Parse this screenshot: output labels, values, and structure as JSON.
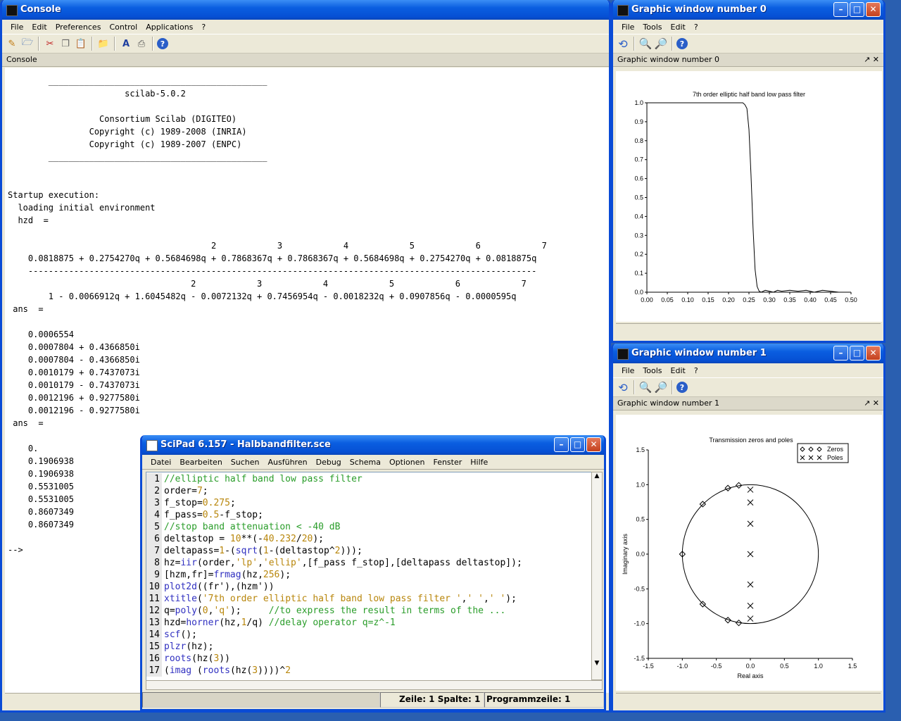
{
  "console": {
    "title": "Console",
    "menu": [
      "File",
      "Edit",
      "Preferences",
      "Control",
      "Applications",
      "?"
    ],
    "tab_label": "Console",
    "lines": [
      "        ___________________________________________",
      "                       scilab-5.0.2",
      "",
      "                  Consortium Scilab (DIGITEO)",
      "                Copyright (c) 1989-2008 (INRIA)",
      "                Copyright (c) 1989-2007 (ENPC)",
      "        ___________________________________________",
      "",
      "",
      "Startup execution:",
      "  loading initial environment",
      "  hzd  =",
      "",
      "                                        2            3            4            5            6            7",
      "    0.0818875 + 0.2754270q + 0.5684698q + 0.7868367q + 0.7868367q + 0.5684698q + 0.2754270q + 0.0818875q",
      "    ----------------------------------------------------------------------------------------------------",
      "                                    2            3            4            5            6            7",
      "        1 - 0.0066912q + 1.6045482q - 0.0072132q + 0.7456954q - 0.0018232q + 0.0907856q - 0.0000595q",
      " ans  =",
      "",
      "    0.0006554",
      "    0.0007804 + 0.4366850i",
      "    0.0007804 - 0.4366850i",
      "    0.0010179 + 0.7437073i",
      "    0.0010179 - 0.7437073i",
      "    0.0012196 + 0.9277580i",
      "    0.0012196 - 0.9277580i",
      " ans  =",
      "",
      "    0.",
      "    0.1906938",
      "    0.1906938",
      "    0.5531005",
      "    0.5531005",
      "    0.8607349",
      "    0.8607349",
      "",
      "-->"
    ]
  },
  "gw0": {
    "title": "Graphic window number 0",
    "menu": [
      "File",
      "Tools",
      "Edit",
      "?"
    ],
    "tab_label": "Graphic window number 0",
    "dock_controls": "↗ ✕",
    "chart_data": {
      "type": "line",
      "title": "7th order elliptic half band low pass filter",
      "xlabel": "",
      "ylabel": "",
      "xlim": [
        0,
        0.5
      ],
      "ylim": [
        0,
        1.0
      ],
      "x_ticks": [
        "0.00",
        "0.05",
        "0.10",
        "0.15",
        "0.20",
        "0.25",
        "0.30",
        "0.35",
        "0.40",
        "0.45",
        "0.50"
      ],
      "y_ticks": [
        "0.0",
        "0.1",
        "0.2",
        "0.3",
        "0.4",
        "0.5",
        "0.6",
        "0.7",
        "0.8",
        "0.9",
        "1.0"
      ],
      "series": [
        {
          "x": [
            0,
            0.22,
            0.235,
            0.24,
            0.245,
            0.25,
            0.255,
            0.26,
            0.265,
            0.27,
            0.275,
            0.28,
            0.29,
            0.3,
            0.31,
            0.32,
            0.33,
            0.35,
            0.37,
            0.39,
            0.41,
            0.43,
            0.45,
            0.47,
            0.5
          ],
          "y": [
            1.0,
            1.0,
            1.0,
            0.99,
            0.97,
            0.86,
            0.62,
            0.34,
            0.12,
            0.03,
            0.005,
            0.0,
            0.01,
            0.005,
            0.0,
            0.01,
            0.005,
            0.01,
            0.005,
            0.01,
            0.0,
            0.01,
            0.005,
            0.0,
            0.0
          ]
        }
      ]
    }
  },
  "gw1": {
    "title": "Graphic window number 1",
    "menu": [
      "File",
      "Tools",
      "Edit",
      "?"
    ],
    "tab_label": "Graphic window number 1",
    "dock_controls": "↗ ✕",
    "chart_data": {
      "type": "scatter",
      "title": "Transmission zeros and poles",
      "xlabel": "Real axis",
      "ylabel": "Imaginary axis",
      "xlim": [
        -1.5,
        1.5
      ],
      "ylim": [
        -1.5,
        1.5
      ],
      "x_ticks": [
        "-1.5",
        "-1.0",
        "-0.5",
        "0.0",
        "0.5",
        "1.0",
        "1.5"
      ],
      "y_ticks": [
        "-1.5",
        "-1.0",
        "-0.5",
        "0.0",
        "0.5",
        "1.0",
        "1.5"
      ],
      "series": [
        {
          "name": "Zeros",
          "marker": "diamond",
          "x": [
            -1.0,
            -0.7,
            -0.7,
            -0.33,
            -0.33,
            -0.17,
            -0.17
          ],
          "y": [
            0.0,
            0.72,
            -0.72,
            0.95,
            -0.95,
            0.99,
            -0.99
          ]
        },
        {
          "name": "Poles",
          "marker": "cross",
          "x": [
            0.0,
            0.0,
            0.0,
            0.0,
            0.0,
            0.0,
            0.0
          ],
          "y": [
            0.0,
            0.437,
            -0.437,
            0.744,
            -0.744,
            0.928,
            -0.928
          ]
        }
      ]
    }
  },
  "scipad": {
    "title": "SciPad 6.157 - Halbbandfilter.sce",
    "menu": [
      "Datei",
      "Bearbeiten",
      "Suchen",
      "Ausführen",
      "Debug",
      "Schema",
      "Optionen",
      "Fenster",
      "Hilfe"
    ],
    "status_pos": "Zeile: 1 Spalte: 1",
    "status_prog": "Programmzeile: 1",
    "code": [
      [
        [
          "cm",
          "//elliptic half band low pass filter"
        ]
      ],
      [
        [
          "pl",
          "order="
        ],
        [
          "nm",
          "7"
        ],
        [
          "pl",
          ";"
        ]
      ],
      [
        [
          "pl",
          "f_stop="
        ],
        [
          "nm",
          "0.275"
        ],
        [
          "pl",
          ";"
        ]
      ],
      [
        [
          "pl",
          "f_pass="
        ],
        [
          "nm",
          "0.5"
        ],
        [
          "pl",
          "-f_stop;"
        ]
      ],
      [
        [
          "cm",
          "//stop band attenuation < -40 dB"
        ]
      ],
      [
        [
          "pl",
          "deltastop = "
        ],
        [
          "nm",
          "10"
        ],
        [
          "pl",
          "**(-"
        ],
        [
          "nm",
          "40.232"
        ],
        [
          "pl",
          "/"
        ],
        [
          "nm",
          "20"
        ],
        [
          "pl",
          ");"
        ]
      ],
      [
        [
          "pl",
          "deltapass="
        ],
        [
          "nm",
          "1"
        ],
        [
          "pl",
          "-("
        ],
        [
          "fn",
          "sqrt"
        ],
        [
          "pl",
          "("
        ],
        [
          "nm",
          "1"
        ],
        [
          "pl",
          "-(deltastop^"
        ],
        [
          "nm",
          "2"
        ],
        [
          "pl",
          ")));"
        ]
      ],
      [
        [
          "pl",
          "hz="
        ],
        [
          "fn",
          "iir"
        ],
        [
          "pl",
          "(order,"
        ],
        [
          "str",
          "'lp'"
        ],
        [
          "pl",
          ","
        ],
        [
          "str",
          "'ellip'"
        ],
        [
          "pl",
          ",[f_pass f_stop],[deltapass deltastop]);"
        ]
      ],
      [
        [
          "pl",
          "[hzm,fr]="
        ],
        [
          "fn",
          "frmag"
        ],
        [
          "pl",
          "(hz,"
        ],
        [
          "nm",
          "256"
        ],
        [
          "pl",
          ");"
        ]
      ],
      [
        [
          "fn",
          "plot2d"
        ],
        [
          "pl",
          "((fr'),(hzm'))"
        ]
      ],
      [
        [
          "fn",
          "xtitle"
        ],
        [
          "pl",
          "("
        ],
        [
          "str",
          "'7th order elliptic half band low pass filter '"
        ],
        [
          "pl",
          ","
        ],
        [
          "str",
          "' '"
        ],
        [
          "pl",
          ","
        ],
        [
          "str",
          "' '"
        ],
        [
          "pl",
          ");"
        ]
      ],
      [
        [
          "pl",
          "q="
        ],
        [
          "fn",
          "poly"
        ],
        [
          "pl",
          "("
        ],
        [
          "nm",
          "0"
        ],
        [
          "pl",
          ","
        ],
        [
          "str",
          "'q'"
        ],
        [
          "pl",
          ");     "
        ],
        [
          "cm",
          "//to express the result in terms of the ..."
        ]
      ],
      [
        [
          "pl",
          "hzd="
        ],
        [
          "fn",
          "horner"
        ],
        [
          "pl",
          "(hz,"
        ],
        [
          "nm",
          "1"
        ],
        [
          "pl",
          "/q) "
        ],
        [
          "cm",
          "//delay operator q=z^-1"
        ]
      ],
      [
        [
          "fn",
          "scf"
        ],
        [
          "pl",
          "();"
        ]
      ],
      [
        [
          "fn",
          "plzr"
        ],
        [
          "pl",
          "(hz);"
        ]
      ],
      [
        [
          "fn",
          "roots"
        ],
        [
          "pl",
          "(hz("
        ],
        [
          "nm",
          "3"
        ],
        [
          "pl",
          "))"
        ]
      ],
      [
        [
          "pl",
          "("
        ],
        [
          "fn",
          "imag"
        ],
        [
          "pl",
          " ("
        ],
        [
          "fn",
          "roots"
        ],
        [
          "pl",
          "(hz("
        ],
        [
          "nm",
          "3"
        ],
        [
          "pl",
          "))))^"
        ],
        [
          "nm",
          "2"
        ]
      ]
    ]
  }
}
